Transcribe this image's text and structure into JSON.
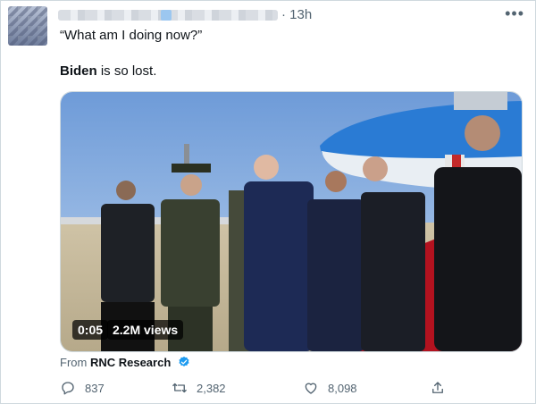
{
  "tweet": {
    "time": "· 13h",
    "more_icon": "more-horizontal-icon",
    "line1": "“What am I doing now?”",
    "line2_bold": "Biden",
    "line2_rest": " is so lost."
  },
  "video": {
    "duration": "0:05",
    "views": "2.2M views"
  },
  "source": {
    "prefix": "From ",
    "name": "RNC Research",
    "verified_icon": "verified-badge-icon",
    "verified_color": "#1d9bf0"
  },
  "actions": {
    "reply_count": "837",
    "retweet_count": "2,382",
    "like_count": "8,098",
    "reply_icon": "reply-icon",
    "retweet_icon": "retweet-icon",
    "like_icon": "heart-icon",
    "share_icon": "share-icon"
  },
  "colors": {
    "text": "#0f1419",
    "secondary": "#536471",
    "border": "#cfd9de"
  }
}
